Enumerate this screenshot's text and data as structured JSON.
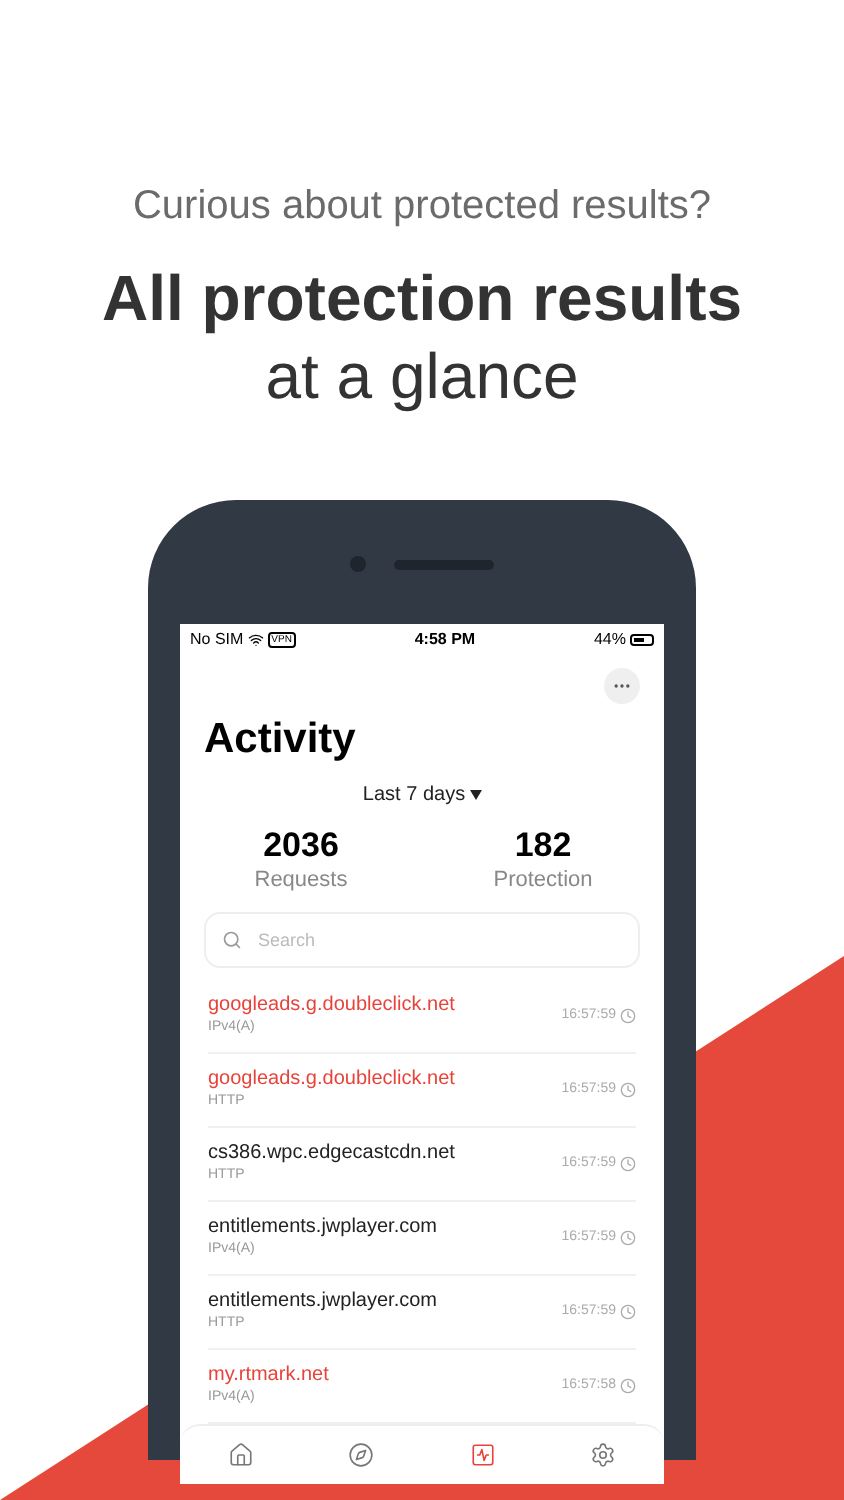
{
  "headline": {
    "subtitle": "Curious about protected results?",
    "title": "All protection results",
    "title_rest": "at a glance"
  },
  "status_bar": {
    "carrier": "No SIM",
    "vpn": "VPN",
    "time": "4:58 PM",
    "battery": "44%"
  },
  "screen": {
    "title": "Activity",
    "period": "Last 7 days",
    "stats": [
      {
        "value": "2036",
        "label": "Requests"
      },
      {
        "value": "182",
        "label": "Protection"
      }
    ],
    "search": {
      "placeholder": "Search"
    },
    "requests": [
      {
        "domain": "googleads.g.doubleclick.net",
        "type": "IPv4(A)",
        "time": "16:57:59",
        "blocked": true
      },
      {
        "domain": "googleads.g.doubleclick.net",
        "type": "HTTP",
        "time": "16:57:59",
        "blocked": true
      },
      {
        "domain": "cs386.wpc.edgecastcdn.net",
        "type": "HTTP",
        "time": "16:57:59",
        "blocked": false
      },
      {
        "domain": "entitlements.jwplayer.com",
        "type": "IPv4(A)",
        "time": "16:57:59",
        "blocked": false
      },
      {
        "domain": "entitlements.jwplayer.com",
        "type": "HTTP",
        "time": "16:57:59",
        "blocked": false
      },
      {
        "domain": "my.rtmark.net",
        "type": "IPv4(A)",
        "time": "16:57:58",
        "blocked": true
      }
    ],
    "tabs": [
      {
        "kind": "home",
        "selected": false
      },
      {
        "kind": "explore",
        "selected": false
      },
      {
        "kind": "activity",
        "selected": true
      },
      {
        "kind": "settings",
        "selected": false
      }
    ]
  }
}
